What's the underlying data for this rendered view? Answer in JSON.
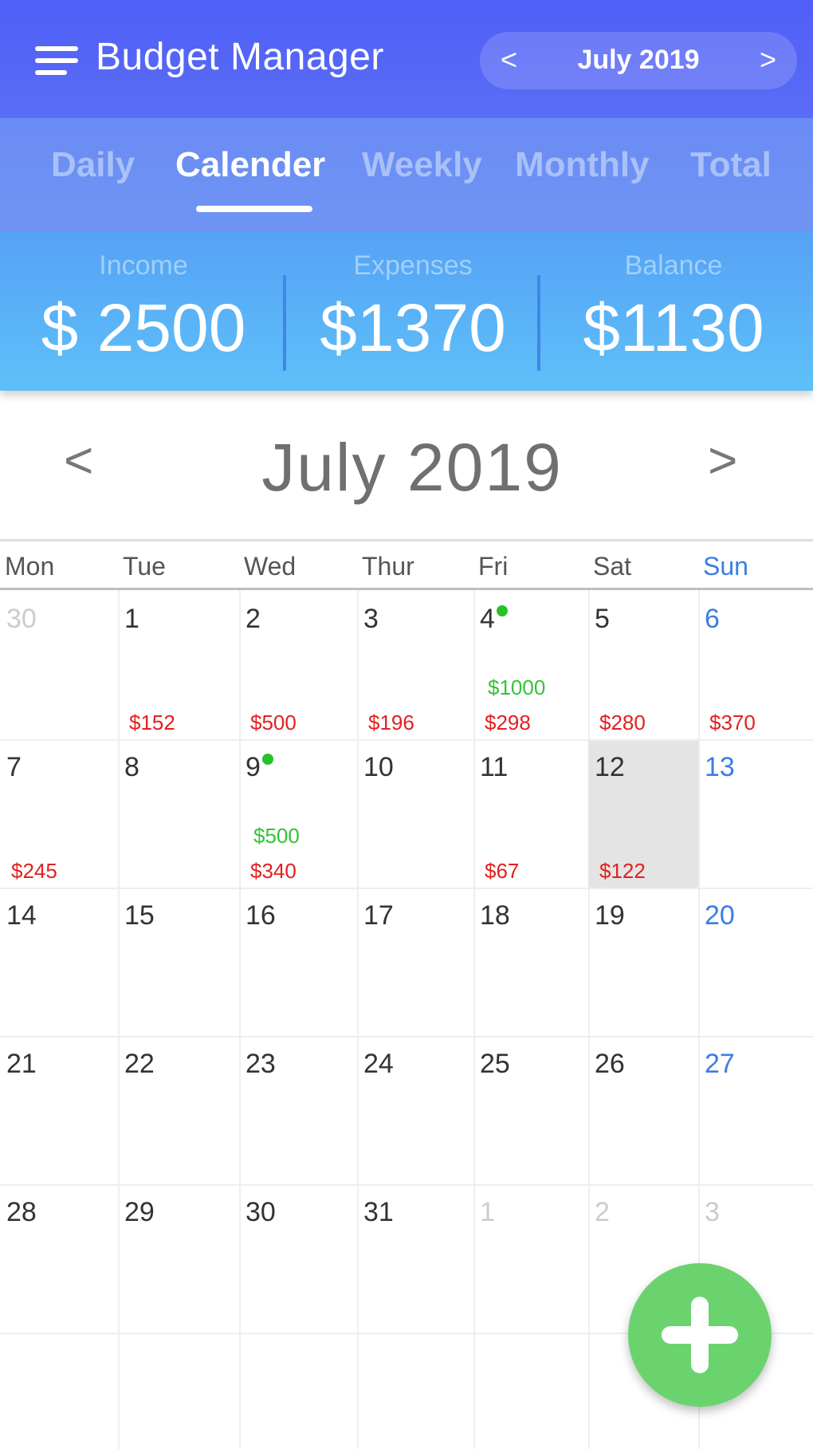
{
  "header": {
    "title": "Budget Manager",
    "month_selector": {
      "prev": "<",
      "label": "July  2019",
      "next": ">"
    }
  },
  "tabs": [
    {
      "label": "Daily",
      "active": false
    },
    {
      "label": "Calender",
      "active": true
    },
    {
      "label": "Weekly",
      "active": false
    },
    {
      "label": "Monthly",
      "active": false
    },
    {
      "label": "Total",
      "active": false
    }
  ],
  "summary": {
    "income": {
      "label": "Income",
      "value": "$ 2500"
    },
    "expenses": {
      "label": "Expenses",
      "value": "$1370"
    },
    "balance": {
      "label": "Balance",
      "value": "$1130"
    }
  },
  "calendar": {
    "prev": "<",
    "title": "July  2019",
    "next": ">",
    "weekdays": [
      "Mon",
      "Tue",
      "Wed",
      "Thur",
      "Fri",
      "Sat",
      "Sun"
    ],
    "weeks": [
      [
        {
          "day": "30",
          "other": true
        },
        {
          "day": "1",
          "expense": "$152"
        },
        {
          "day": "2",
          "expense": "$500"
        },
        {
          "day": "3",
          "expense": "$196"
        },
        {
          "day": "4",
          "income": "$1000",
          "expense": "$298",
          "dot": true
        },
        {
          "day": "5",
          "expense": "$280"
        },
        {
          "day": "6",
          "expense": "$370"
        }
      ],
      [
        {
          "day": "7",
          "expense": "$245"
        },
        {
          "day": "8"
        },
        {
          "day": "9",
          "income": "$500",
          "expense": "$340",
          "dot": true
        },
        {
          "day": "10"
        },
        {
          "day": "11",
          "expense": "$67"
        },
        {
          "day": "12",
          "expense": "$122",
          "today": true
        },
        {
          "day": "13"
        }
      ],
      [
        {
          "day": "14"
        },
        {
          "day": "15"
        },
        {
          "day": "16"
        },
        {
          "day": "17"
        },
        {
          "day": "18"
        },
        {
          "day": "19"
        },
        {
          "day": "20"
        }
      ],
      [
        {
          "day": "21"
        },
        {
          "day": "22"
        },
        {
          "day": "23"
        },
        {
          "day": "24"
        },
        {
          "day": "25"
        },
        {
          "day": "26"
        },
        {
          "day": "27"
        }
      ],
      [
        {
          "day": "28"
        },
        {
          "day": "29"
        },
        {
          "day": "30"
        },
        {
          "day": "31"
        },
        {
          "day": "1",
          "other": true
        },
        {
          "day": "2",
          "other": true
        },
        {
          "day": "3",
          "other": true
        }
      ]
    ]
  },
  "fab": {
    "icon": "plus-icon"
  },
  "colors": {
    "header": "#4f5ff7",
    "income": "#35c335",
    "expense": "#e32020",
    "sunday": "#3b7de8",
    "fab": "#6bd36e"
  }
}
